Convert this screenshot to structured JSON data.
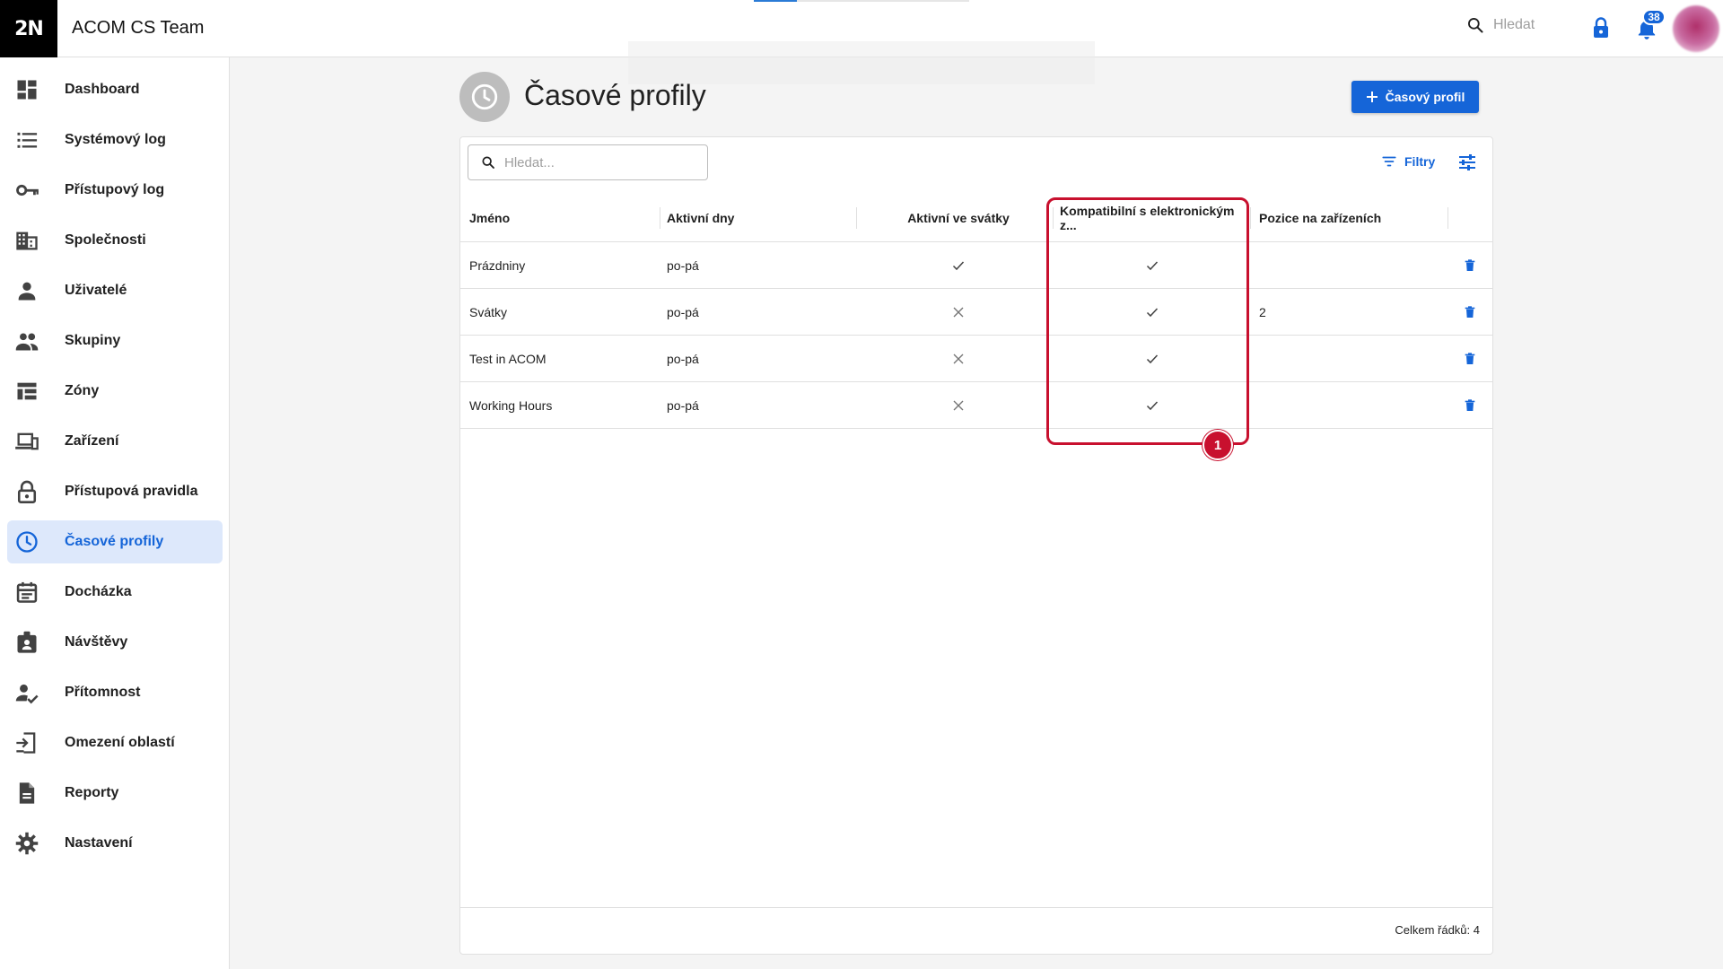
{
  "app": {
    "logo_text": "2N",
    "title": "ACOM CS Team"
  },
  "topbar": {
    "search_placeholder": "Hledat",
    "notifications_count": "38",
    "progress_fraction": 0.2
  },
  "sidebar": {
    "items": [
      {
        "label": "Dashboard",
        "icon": "dashboard-icon",
        "active": false
      },
      {
        "label": "Systémový log",
        "icon": "list-icon",
        "active": false
      },
      {
        "label": "Přístupový log",
        "icon": "key-icon",
        "active": false
      },
      {
        "label": "Společnosti",
        "icon": "building-icon",
        "active": false
      },
      {
        "label": "Uživatelé",
        "icon": "person-icon",
        "active": false
      },
      {
        "label": "Skupiny",
        "icon": "group-icon",
        "active": false
      },
      {
        "label": "Zóny",
        "icon": "zones-icon",
        "active": false
      },
      {
        "label": "Zařízení",
        "icon": "devices-icon",
        "active": false
      },
      {
        "label": "Přístupová pravidla",
        "icon": "lock-icon",
        "active": false
      },
      {
        "label": "Časové profily",
        "icon": "clock-icon",
        "active": true
      },
      {
        "label": "Docházka",
        "icon": "calendar-icon",
        "active": false
      },
      {
        "label": "Návštěvy",
        "icon": "badge-icon",
        "active": false
      },
      {
        "label": "Přítomnost",
        "icon": "person-check-icon",
        "active": false
      },
      {
        "label": "Omezení oblastí",
        "icon": "area-restriction-icon",
        "active": false
      },
      {
        "label": "Reporty",
        "icon": "document-icon",
        "active": false
      },
      {
        "label": "Nastavení",
        "icon": "gear-icon",
        "active": false
      }
    ]
  },
  "page": {
    "title": "Časové profily",
    "add_button_label": "Časový profil"
  },
  "table": {
    "search_placeholder": "Hledat...",
    "filters_label": "Filtry",
    "columns": [
      "Jméno",
      "Aktivní dny",
      "Aktivní ve svátky",
      "Kompatibilní s elektronickým z...",
      "Pozice na zařízeních"
    ],
    "rows": [
      {
        "name": "Prázdniny",
        "days": "po-pá",
        "holidays": true,
        "compatible": true,
        "position": ""
      },
      {
        "name": "Svátky",
        "days": "po-pá",
        "holidays": false,
        "compatible": true,
        "position": "2"
      },
      {
        "name": "Test in ACOM",
        "days": "po-pá",
        "holidays": false,
        "compatible": true,
        "position": ""
      },
      {
        "name": "Working Hours",
        "days": "po-pá",
        "holidays": false,
        "compatible": true,
        "position": ""
      }
    ],
    "row_count_text": "Celkem řádků: 4"
  },
  "annotation": {
    "marker_number": "1",
    "color": "#c8102e"
  },
  "colors": {
    "accent": "#1565d8",
    "active_bg": "#dde8fb"
  }
}
